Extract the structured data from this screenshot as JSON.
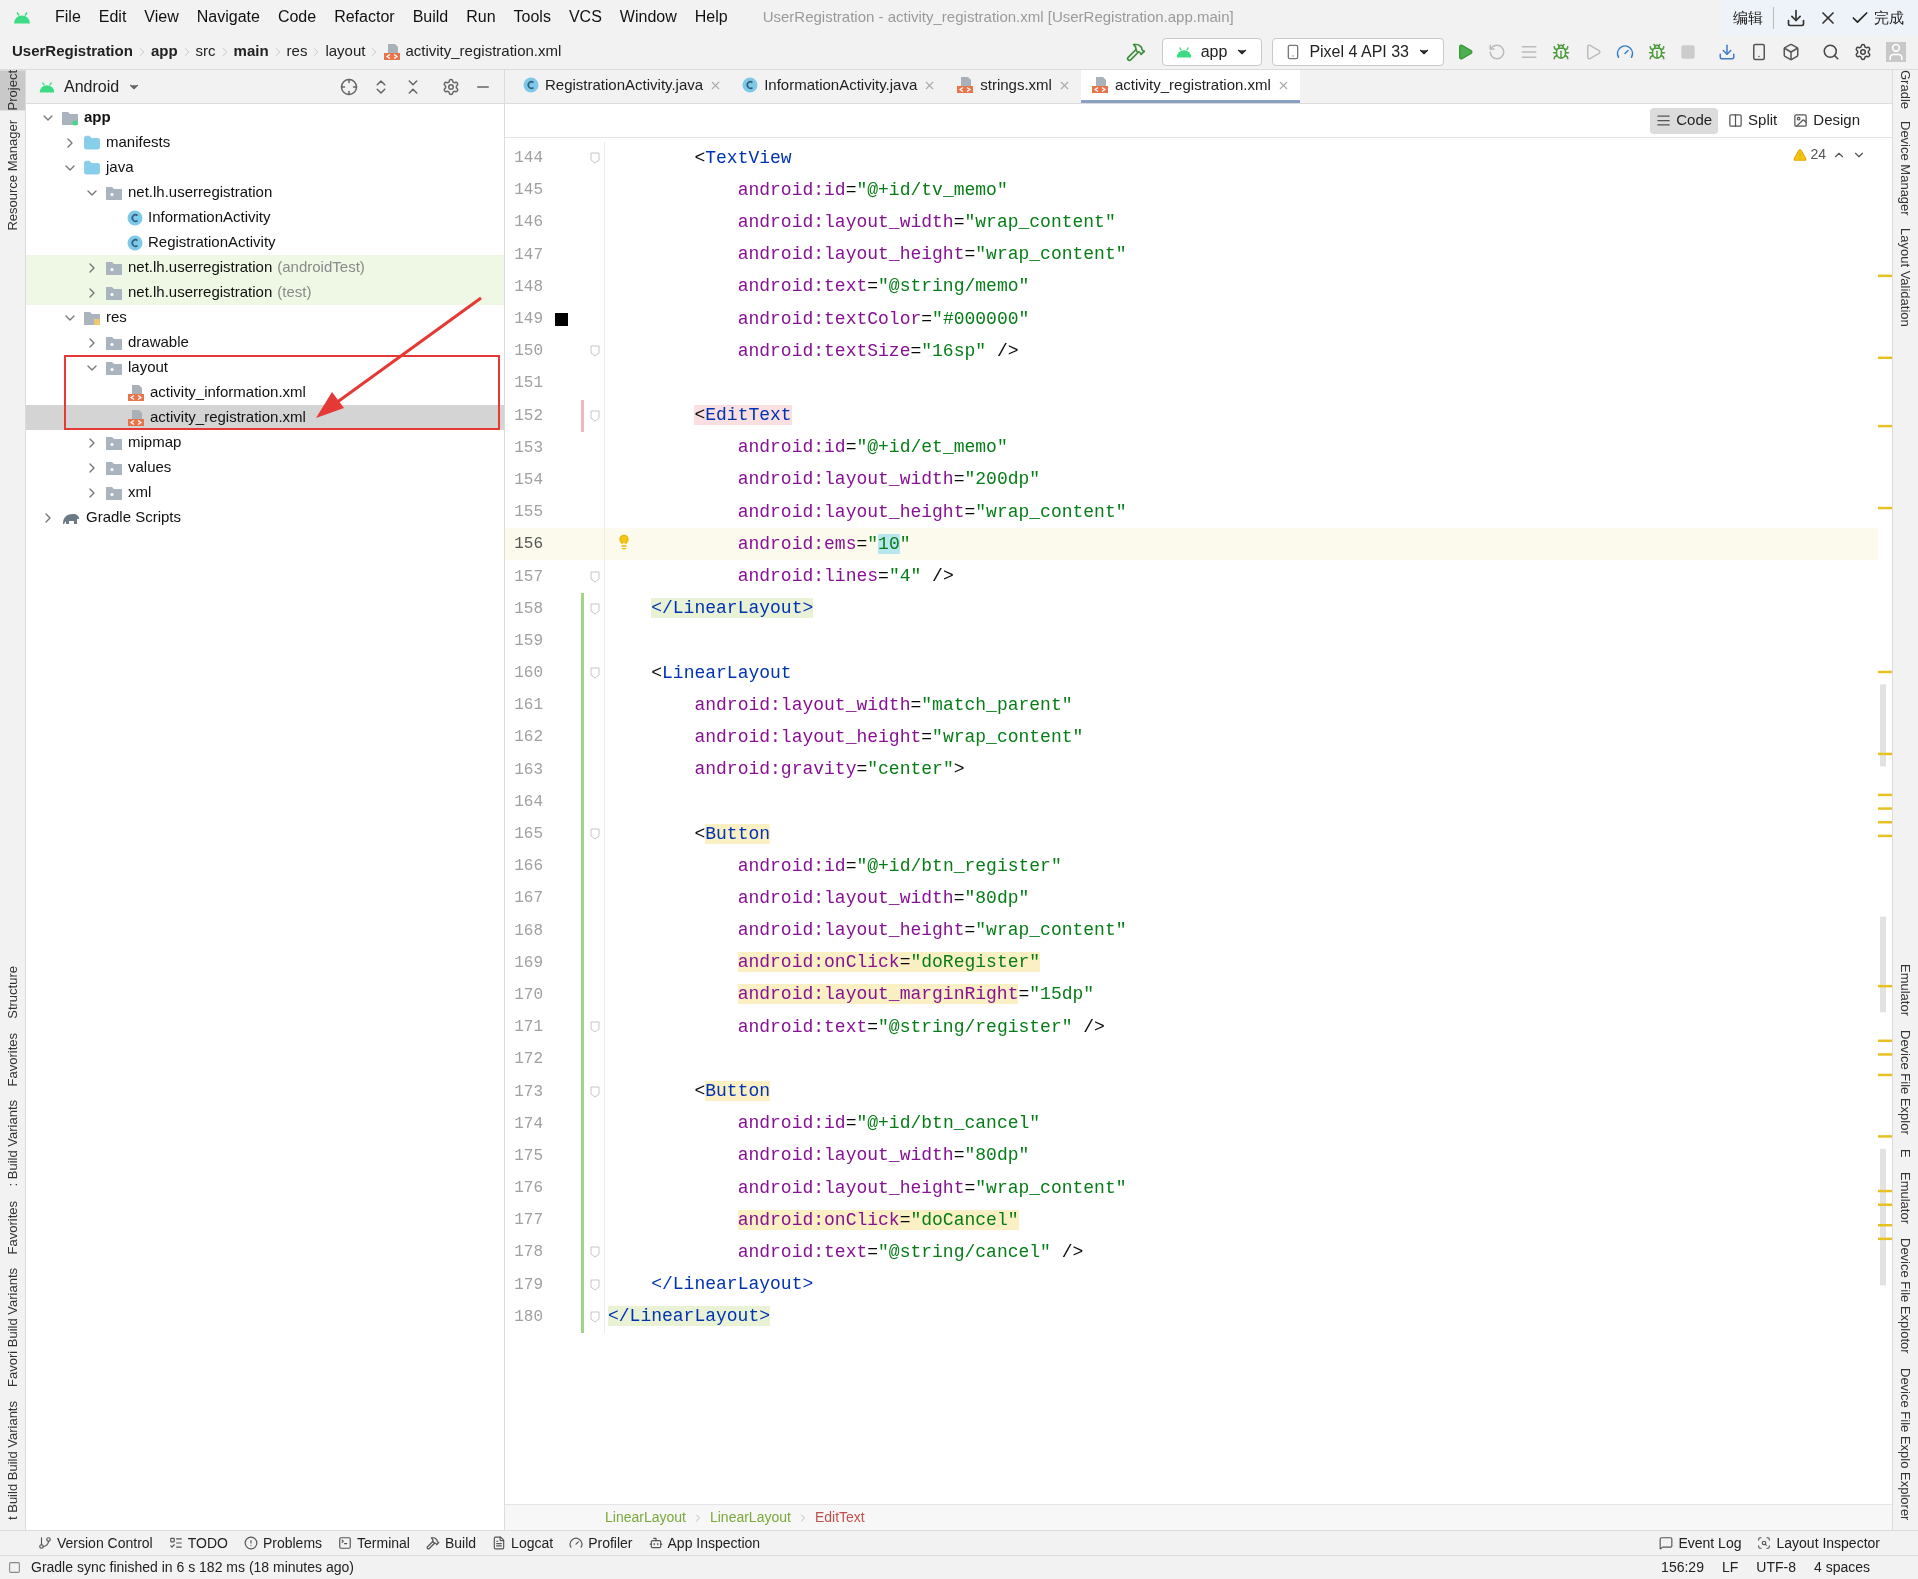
{
  "window": {
    "title": "UserRegistration - activity_registration.xml [UserRegistration.app.main]"
  },
  "menu": [
    "File",
    "Edit",
    "View",
    "Navigate",
    "Code",
    "Refactor",
    "Build",
    "Run",
    "Tools",
    "VCS",
    "Window",
    "Help"
  ],
  "capture_toolbar": {
    "edit": "编辑",
    "done": "完成"
  },
  "breadcrumb": [
    {
      "label": "UserRegistration",
      "bold": true
    },
    {
      "label": "app",
      "bold": true
    },
    {
      "label": "src",
      "bold": false
    },
    {
      "label": "main",
      "bold": true
    },
    {
      "label": "res",
      "bold": false
    },
    {
      "label": "layout",
      "bold": false
    },
    {
      "label": "activity_registration.xml",
      "bold": false,
      "kind": "file"
    }
  ],
  "run_toolbar": {
    "configuration": "app",
    "device": "Pixel 4 API 33"
  },
  "left_strip": {
    "top": [
      {
        "label": "Project",
        "selected": true
      },
      {
        "label": "Resource Manager",
        "selected": false
      }
    ],
    "bottom": [
      {
        "label": "Structure",
        "selected": false
      },
      {
        "label": "Favorites",
        "selected": false
      },
      {
        "label": ": Build Variants",
        "selected": false
      },
      {
        "label": "Favorites",
        "selected": false
      },
      {
        "label": "Favori Build Variants",
        "selected": false
      },
      {
        "label": "t Build Build Variants",
        "selected": false
      }
    ]
  },
  "right_strip": {
    "top": [
      {
        "label": "Gradle"
      },
      {
        "label": "Device Manager"
      },
      {
        "label": "Layout Validation"
      }
    ],
    "bottom": [
      {
        "label": "Emulator"
      },
      {
        "label": "Device File Explor"
      },
      {
        "label": "E"
      },
      {
        "label": "Emulator"
      },
      {
        "label": "Device File Explotor"
      },
      {
        "label": "Device File Explo Explorer"
      }
    ]
  },
  "project": {
    "view": "Android",
    "tree": [
      {
        "label": "app",
        "kind": "module",
        "bold": true,
        "expanded": true,
        "selected": false,
        "children": [
          {
            "label": "manifests",
            "kind": "source",
            "expanded": false,
            "selected": false
          },
          {
            "label": "java",
            "kind": "source",
            "expanded": true,
            "selected": false,
            "children": [
              {
                "label": "net.lh.userregistration",
                "kind": "package",
                "expanded": true,
                "selected": false,
                "children": [
                  {
                    "label": "InformationActivity",
                    "kind": "class",
                    "selected": false
                  },
                  {
                    "label": "RegistrationActivity",
                    "kind": "class",
                    "selected": false
                  }
                ]
              },
              {
                "label": "net.lh.userregistration",
                "note": "(androidTest)",
                "kind": "package",
                "expanded": false,
                "selected": false,
                "test_source": true
              },
              {
                "label": "net.lh.userregistration",
                "note": "(test)",
                "kind": "package",
                "expanded": false,
                "selected": false,
                "test_source": true
              }
            ]
          },
          {
            "label": "res",
            "kind": "res",
            "expanded": true,
            "selected": false,
            "children": [
              {
                "label": "drawable",
                "kind": "package",
                "expanded": false,
                "selected": false
              },
              {
                "label": "layout",
                "kind": "package",
                "expanded": true,
                "selected": false,
                "annotated": true,
                "children": [
                  {
                    "label": "activity_information.xml",
                    "kind": "xml",
                    "selected": false
                  },
                  {
                    "label": "activity_registration.xml",
                    "kind": "xml",
                    "selected": true
                  }
                ]
              },
              {
                "label": "mipmap",
                "kind": "package",
                "expanded": false,
                "selected": false
              },
              {
                "label": "values",
                "kind": "package",
                "expanded": false,
                "selected": false
              },
              {
                "label": "xml",
                "kind": "package",
                "expanded": false,
                "selected": false
              }
            ]
          }
        ]
      },
      {
        "label": "Gradle Scripts",
        "kind": "gradle",
        "expanded": false,
        "selected": false
      }
    ]
  },
  "editor_tabs": [
    {
      "label": "RegistrationActivity.java",
      "kind": "java",
      "selected": false
    },
    {
      "label": "InformationActivity.java",
      "kind": "java",
      "selected": false
    },
    {
      "label": "strings.xml",
      "kind": "xml",
      "selected": false
    },
    {
      "label": "activity_registration.xml",
      "kind": "xml",
      "selected": true
    }
  ],
  "view_modes": [
    {
      "label": "Code",
      "kind": "code",
      "selected": true
    },
    {
      "label": "Split",
      "kind": "split",
      "selected": false
    },
    {
      "label": "Design",
      "kind": "design",
      "selected": false
    }
  ],
  "warnings": {
    "count": "24"
  },
  "code_lines": [
    {
      "number": "144",
      "fold": true,
      "tokens": [
        {
          "kind": "punct",
          "text": "        <"
        },
        {
          "kind": "tag",
          "text": "TextView"
        }
      ]
    },
    {
      "number": "145",
      "tokens": [
        {
          "kind": "attr",
          "text": "            android:id"
        },
        {
          "kind": "punct",
          "text": "="
        },
        {
          "kind": "value",
          "text": "\"@+id/tv_memo\""
        }
      ]
    },
    {
      "number": "146",
      "tokens": [
        {
          "kind": "attr",
          "text": "            android:layout_width"
        },
        {
          "kind": "punct",
          "text": "="
        },
        {
          "kind": "value",
          "text": "\"wrap_content\""
        }
      ]
    },
    {
      "number": "147",
      "tokens": [
        {
          "kind": "attr",
          "text": "            android:layout_height"
        },
        {
          "kind": "punct",
          "text": "="
        },
        {
          "kind": "value",
          "text": "\"wrap_content\""
        }
      ]
    },
    {
      "number": "148",
      "tokens": [
        {
          "kind": "attr",
          "text": "            android:text"
        },
        {
          "kind": "punct",
          "text": "="
        },
        {
          "kind": "value",
          "text": "\"@string/memo\""
        }
      ]
    },
    {
      "number": "149",
      "color": "#000000",
      "tokens": [
        {
          "kind": "attr",
          "text": "            android:textColor"
        },
        {
          "kind": "punct",
          "text": "="
        },
        {
          "kind": "value",
          "text": "\"#000000\""
        }
      ]
    },
    {
      "number": "150",
      "fold": true,
      "tokens": [
        {
          "kind": "attr",
          "text": "            android:textSize"
        },
        {
          "kind": "punct",
          "text": "="
        },
        {
          "kind": "value",
          "text": "\"16sp\""
        },
        {
          "kind": "punct",
          "text": " />"
        }
      ]
    },
    {
      "number": "151"
    },
    {
      "number": "152",
      "fold": true,
      "modified": true,
      "tokens": [
        {
          "kind": "punct",
          "text": "        <",
          "error": true
        },
        {
          "kind": "tag",
          "text": "EditText",
          "error": true
        }
      ]
    },
    {
      "number": "153",
      "tokens": [
        {
          "kind": "attr",
          "text": "            android:id"
        },
        {
          "kind": "punct",
          "text": "="
        },
        {
          "kind": "value",
          "text": "\"@+id/et_memo\""
        }
      ]
    },
    {
      "number": "154",
      "tokens": [
        {
          "kind": "attr",
          "text": "            android:layout_width"
        },
        {
          "kind": "punct",
          "text": "="
        },
        {
          "kind": "value",
          "text": "\"200dp\""
        }
      ]
    },
    {
      "number": "155",
      "tokens": [
        {
          "kind": "attr",
          "text": "            android:layout_height"
        },
        {
          "kind": "punct",
          "text": "="
        },
        {
          "kind": "value",
          "text": "\"wrap_content\""
        }
      ]
    },
    {
      "number": "156",
      "current": true,
      "bulb": true,
      "tokens": [
        {
          "kind": "attr",
          "text": "            android:ems"
        },
        {
          "kind": "punct",
          "text": "="
        },
        {
          "kind": "value",
          "text": "\""
        },
        {
          "kind": "value",
          "text": "10",
          "caret": true
        },
        {
          "kind": "value",
          "text": "\""
        }
      ]
    },
    {
      "number": "157",
      "fold": true,
      "tokens": [
        {
          "kind": "attr",
          "text": "            android:lines"
        },
        {
          "kind": "punct",
          "text": "="
        },
        {
          "kind": "value",
          "text": "\"4\""
        },
        {
          "kind": "punct",
          "text": " />"
        }
      ]
    },
    {
      "number": "158",
      "fold": true,
      "changed": true,
      "tokens": [
        {
          "kind": "tag",
          "text": "    </LinearLayout>",
          "matched": true
        }
      ]
    },
    {
      "number": "159",
      "changed": true
    },
    {
      "number": "160",
      "fold": true,
      "changed": true,
      "tokens": [
        {
          "kind": "punct",
          "text": "    <"
        },
        {
          "kind": "tag",
          "text": "LinearLayout"
        }
      ]
    },
    {
      "number": "161",
      "changed": true,
      "tokens": [
        {
          "kind": "attr",
          "text": "        android:layout_width"
        },
        {
          "kind": "punct",
          "text": "="
        },
        {
          "kind": "value",
          "text": "\"match_parent\""
        }
      ]
    },
    {
      "number": "162",
      "changed": true,
      "tokens": [
        {
          "kind": "attr",
          "text": "        android:layout_height"
        },
        {
          "kind": "punct",
          "text": "="
        },
        {
          "kind": "value",
          "text": "\"wrap_content\""
        }
      ]
    },
    {
      "number": "163",
      "changed": true,
      "tokens": [
        {
          "kind": "attr",
          "text": "        android:gravity"
        },
        {
          "kind": "punct",
          "text": "="
        },
        {
          "kind": "value",
          "text": "\"center\""
        },
        {
          "kind": "punct",
          "text": ">"
        }
      ]
    },
    {
      "number": "164",
      "changed": true
    },
    {
      "number": "165",
      "fold": true,
      "changed": true,
      "tokens": [
        {
          "kind": "punct",
          "text": "        <"
        },
        {
          "kind": "tag",
          "text": "Button",
          "warning": true
        }
      ]
    },
    {
      "number": "166",
      "changed": true,
      "tokens": [
        {
          "kind": "attr",
          "text": "            android:id"
        },
        {
          "kind": "punct",
          "text": "="
        },
        {
          "kind": "value",
          "text": "\"@+id/btn_register\""
        }
      ]
    },
    {
      "number": "167",
      "changed": true,
      "tokens": [
        {
          "kind": "attr",
          "text": "            android:layout_width"
        },
        {
          "kind": "punct",
          "text": "="
        },
        {
          "kind": "value",
          "text": "\"80dp\""
        }
      ]
    },
    {
      "number": "168",
      "changed": true,
      "tokens": [
        {
          "kind": "attr",
          "text": "            android:layout_height"
        },
        {
          "kind": "punct",
          "text": "="
        },
        {
          "kind": "value",
          "text": "\"wrap_content\""
        }
      ]
    },
    {
      "number": "169",
      "changed": true,
      "tokens": [
        {
          "kind": "attr",
          "text": "            android:onClick",
          "warning": true
        },
        {
          "kind": "punct",
          "text": "=",
          "warning": true
        },
        {
          "kind": "value",
          "text": "\"doRegister\"",
          "warning": true
        }
      ]
    },
    {
      "number": "170",
      "changed": true,
      "tokens": [
        {
          "kind": "attr",
          "text": "            android:layout_marginRight",
          "warning": true
        },
        {
          "kind": "punct",
          "text": "="
        },
        {
          "kind": "value",
          "text": "\"15dp\""
        }
      ]
    },
    {
      "number": "171",
      "fold": true,
      "changed": true,
      "tokens": [
        {
          "kind": "attr",
          "text": "            android:text"
        },
        {
          "kind": "punct",
          "text": "="
        },
        {
          "kind": "value",
          "text": "\"@string/register\""
        },
        {
          "kind": "punct",
          "text": " />"
        }
      ]
    },
    {
      "number": "172",
      "changed": true
    },
    {
      "number": "173",
      "fold": true,
      "changed": true,
      "tokens": [
        {
          "kind": "punct",
          "text": "        <"
        },
        {
          "kind": "tag",
          "text": "Button",
          "warning": true
        }
      ]
    },
    {
      "number": "174",
      "changed": true,
      "tokens": [
        {
          "kind": "attr",
          "text": "            android:id"
        },
        {
          "kind": "punct",
          "text": "="
        },
        {
          "kind": "value",
          "text": "\"@+id/btn_cancel\""
        }
      ]
    },
    {
      "number": "175",
      "changed": true,
      "tokens": [
        {
          "kind": "attr",
          "text": "            android:layout_width"
        },
        {
          "kind": "punct",
          "text": "="
        },
        {
          "kind": "value",
          "text": "\"80dp\""
        }
      ]
    },
    {
      "number": "176",
      "changed": true,
      "tokens": [
        {
          "kind": "attr",
          "text": "            android:layout_height"
        },
        {
          "kind": "punct",
          "text": "="
        },
        {
          "kind": "value",
          "text": "\"wrap_content\""
        }
      ]
    },
    {
      "number": "177",
      "changed": true,
      "tokens": [
        {
          "kind": "attr",
          "text": "            android:onClick",
          "warning": true
        },
        {
          "kind": "punct",
          "text": "=",
          "warning": true
        },
        {
          "kind": "value",
          "text": "\"doCancel\"",
          "warning": true
        }
      ]
    },
    {
      "number": "178",
      "fold": true,
      "changed": true,
      "tokens": [
        {
          "kind": "attr",
          "text": "            android:text"
        },
        {
          "kind": "punct",
          "text": "="
        },
        {
          "kind": "value",
          "text": "\"@string/cancel\""
        },
        {
          "kind": "punct",
          "text": " />"
        }
      ]
    },
    {
      "number": "179",
      "fold": true,
      "changed": true,
      "tokens": [
        {
          "kind": "tag",
          "text": "    </LinearLayout>"
        }
      ]
    },
    {
      "number": "180",
      "fold": true,
      "changed": true,
      "tokens": [
        {
          "kind": "tag",
          "text": "</LinearLayout>",
          "matched": true
        }
      ]
    }
  ],
  "code_breadcrumb": [
    {
      "label": "LinearLayout",
      "kind": "ancestor"
    },
    {
      "label": "LinearLayout",
      "kind": "ancestor"
    },
    {
      "label": "EditText",
      "kind": "current"
    }
  ],
  "tool_windows": {
    "left": [
      {
        "label": "Version Control",
        "kind": "vcs"
      },
      {
        "label": "TODO",
        "kind": "todo"
      },
      {
        "label": "Problems",
        "kind": "problems"
      },
      {
        "label": "Terminal",
        "kind": "terminal"
      },
      {
        "label": "Build",
        "kind": "build"
      },
      {
        "label": "Logcat",
        "kind": "logcat"
      },
      {
        "label": "Profiler",
        "kind": "profiler"
      },
      {
        "label": "App Inspection",
        "kind": "inspection"
      }
    ],
    "right": [
      {
        "label": "Event Log",
        "kind": "events"
      },
      {
        "label": "Layout Inspector",
        "kind": "layout"
      }
    ]
  },
  "status_bar": {
    "message": "Gradle sync finished in 6 s 182 ms (18 minutes ago)",
    "items": [
      "156:29",
      "LF",
      "UTF-8",
      "4 spaces"
    ]
  }
}
